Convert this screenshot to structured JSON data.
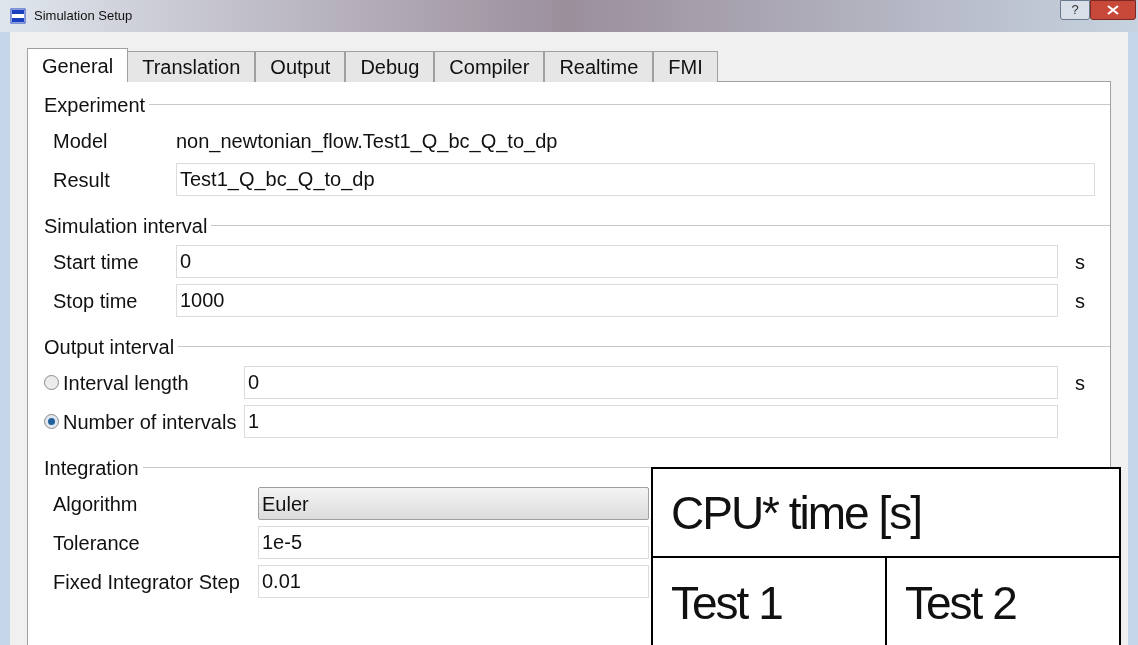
{
  "window": {
    "title": "Simulation Setup",
    "help": "?"
  },
  "tabs": [
    {
      "label": "General",
      "selected": true
    },
    {
      "label": "Translation",
      "selected": false
    },
    {
      "label": "Output",
      "selected": false
    },
    {
      "label": "Debug",
      "selected": false
    },
    {
      "label": "Compiler",
      "selected": false
    },
    {
      "label": "Realtime",
      "selected": false
    },
    {
      "label": "FMI",
      "selected": false
    }
  ],
  "sections": [
    {
      "title": "Experiment",
      "rows": [
        {
          "kind": "text",
          "label": "Model",
          "value": "non_newtonian_flow.Test1_Q_bc_Q_to_dp"
        },
        {
          "kind": "field",
          "label": "Result",
          "value": "Test1_Q_bc_Q_to_dp"
        }
      ]
    },
    {
      "title": "Simulation interval",
      "rows": [
        {
          "kind": "field",
          "label": "Start time",
          "value": "0",
          "unit": "s"
        },
        {
          "kind": "field",
          "label": "Stop time",
          "value": "1000",
          "unit": "s"
        }
      ]
    },
    {
      "title": "Output interval",
      "rows": [
        {
          "kind": "radio",
          "label": "Interval length",
          "value": "0",
          "unit": "s",
          "selected": false
        },
        {
          "kind": "radio",
          "label": "Number of intervals",
          "value": "1",
          "unit": "",
          "selected": true
        }
      ]
    },
    {
      "title": "Integration",
      "rows": [
        {
          "kind": "dropdown",
          "label": "Algorithm",
          "value": "Euler"
        },
        {
          "kind": "field",
          "label": "Tolerance",
          "value": "1e-5"
        },
        {
          "kind": "field",
          "label": "Fixed Integrator Step",
          "value": "0.01"
        }
      ]
    }
  ],
  "overlay_table": {
    "header": "CPU* time [s]",
    "columns": [
      "Test 1",
      "Test 2"
    ]
  }
}
